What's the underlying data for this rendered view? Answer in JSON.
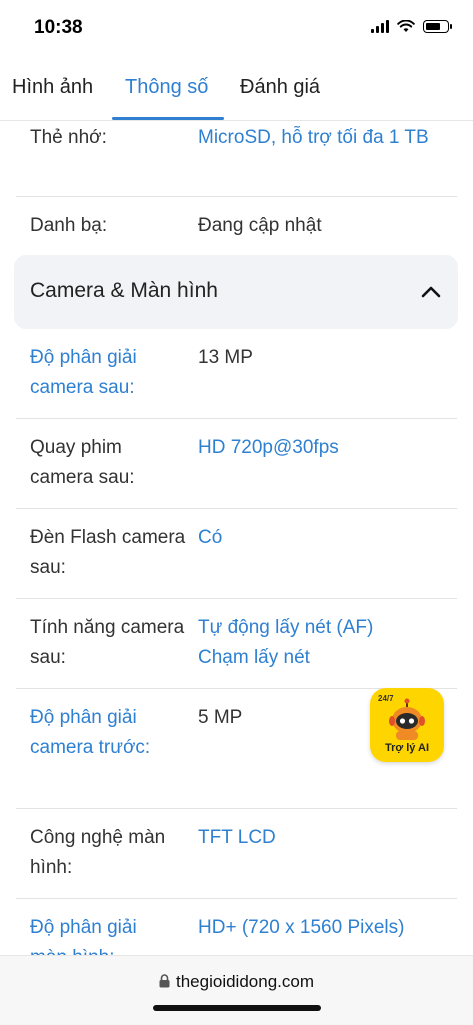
{
  "status": {
    "time": "10:38"
  },
  "tabs": [
    {
      "label": "Hình ảnh"
    },
    {
      "label": "Thông số"
    },
    {
      "label": "Đánh giá"
    }
  ],
  "specs_top": [
    {
      "label": "Thẻ nhớ:",
      "value": "MicroSD, hỗ trợ tối đa 1 TB"
    },
    {
      "label": "Danh bạ:",
      "value": "Đang cập nhật"
    }
  ],
  "section": {
    "title": "Camera & Màn hình"
  },
  "specs": [
    {
      "label": "Độ phân giải camera sau:",
      "value": "13 MP"
    },
    {
      "label": "Quay phim camera sau:",
      "value": "HD 720p@30fps"
    },
    {
      "label": "Đèn Flash camera sau:",
      "value": "Có"
    },
    {
      "label": "Tính năng camera sau:",
      "value": "Tự động lấy nét (AF)",
      "value2": "Chạm lấy nét"
    },
    {
      "label": "Độ phân giải camera trước:",
      "value": "5 MP"
    },
    {
      "label": "Công nghệ màn hình:",
      "value": "TFT LCD"
    },
    {
      "label": "Độ phân giải màn hình:",
      "value": "HD+ (720 x 1560 Pixels)"
    }
  ],
  "ai_assistant": {
    "tag": "24/7",
    "label": "Trợ lý AI"
  },
  "browser": {
    "url": "thegioididong.com"
  },
  "colors": {
    "accent": "#2f80d1",
    "ai_badge": "#ffd500"
  }
}
